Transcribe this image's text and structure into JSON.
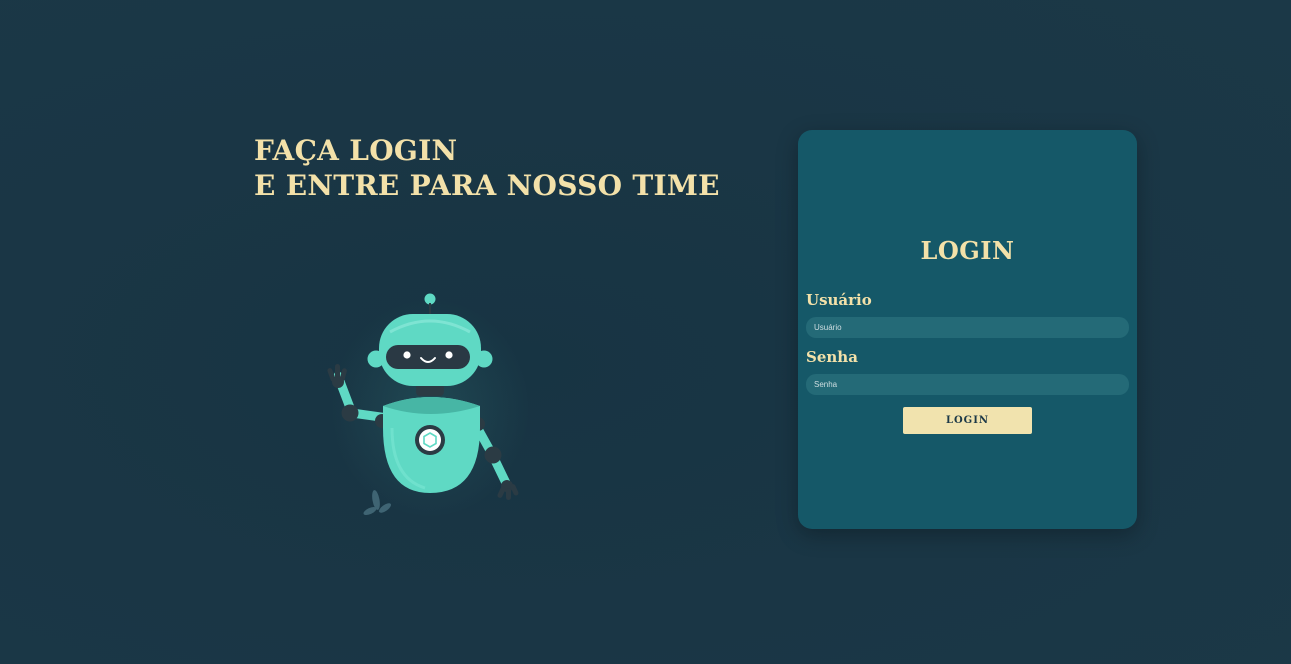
{
  "hero": {
    "line1": "FAÇA LOGIN",
    "line2": "E ENTRE PARA NOSSO TIME"
  },
  "illustration": {
    "icon": "robot-icon"
  },
  "login_card": {
    "title": "LOGIN",
    "username_label": "Usuário",
    "username_placeholder": "Usuário",
    "username_value": "",
    "password_label": "Senha",
    "password_placeholder": "Senha",
    "password_value": "",
    "submit_label": "LOGIN"
  },
  "colors": {
    "background": "#1a3645",
    "card": "#155868",
    "accent": "#f3e1a9",
    "input": "#246a77",
    "robot": "#5fd9c4"
  }
}
